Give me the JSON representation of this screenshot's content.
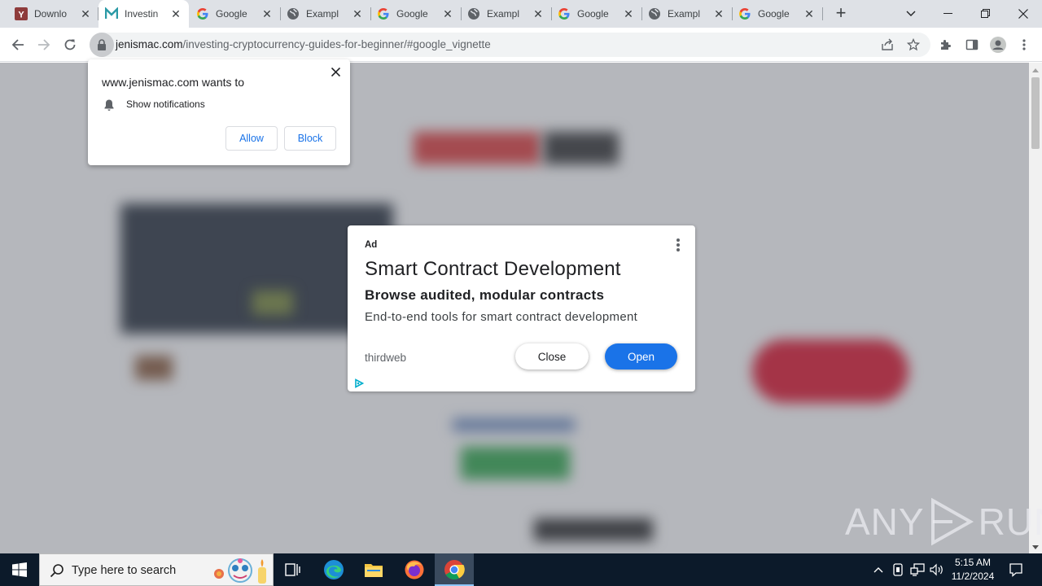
{
  "browser": {
    "tabs": [
      {
        "title": "Downlo",
        "favicon": "y-combinator-favicon",
        "active": false
      },
      {
        "title": "Investin",
        "favicon": "jenismac-favicon",
        "active": true
      },
      {
        "title": "Google",
        "favicon": "google-favicon",
        "active": false
      },
      {
        "title": "Exampl",
        "favicon": "globe-favicon",
        "active": false
      },
      {
        "title": "Google",
        "favicon": "google-favicon",
        "active": false
      },
      {
        "title": "Exampl",
        "favicon": "globe-favicon",
        "active": false
      },
      {
        "title": "Google",
        "favicon": "google-favicon",
        "active": false
      },
      {
        "title": "Exampl",
        "favicon": "globe-favicon",
        "active": false
      },
      {
        "title": "Google",
        "favicon": "google-favicon",
        "active": false
      }
    ],
    "url_host": "jenismac.com",
    "url_path": "/investing-cryptocurrency-guides-for-beginner/#google_vignette"
  },
  "notification_prompt": {
    "title": "www.jenismac.com wants to",
    "permission": "Show notifications",
    "allow_label": "Allow",
    "block_label": "Block"
  },
  "ad": {
    "label": "Ad",
    "headline": "Smart Contract Development",
    "subheadline": "Browse audited, modular contracts",
    "description": "End-to-end tools for smart contract development",
    "advertiser": "thirdweb",
    "close_label": "Close",
    "open_label": "Open",
    "accent_color": "#1a73e8"
  },
  "watermark": {
    "left": "ANY",
    "right": "RUN"
  },
  "taskbar": {
    "search_placeholder": "Type here to search",
    "time": "5:15 AM",
    "date": "11/2/2024"
  }
}
